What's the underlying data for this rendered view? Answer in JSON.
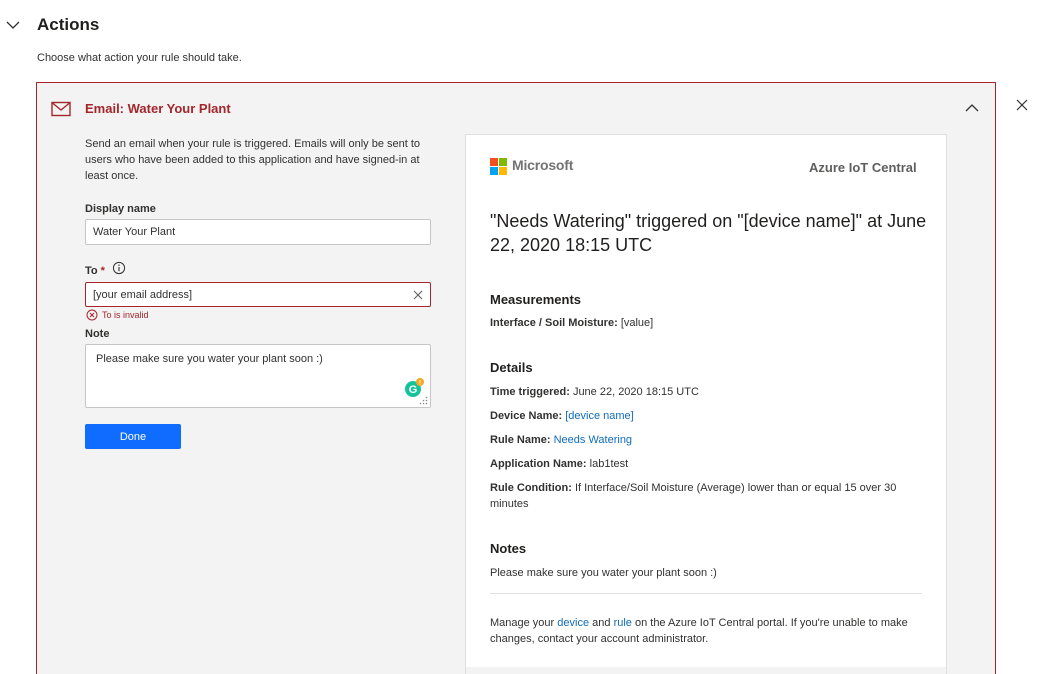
{
  "section": {
    "title": "Actions",
    "description": "Choose what action your rule should take."
  },
  "card": {
    "title": "Email: Water Your Plant",
    "intro": "Send an email when your rule is triggered. Emails will only be sent to users who have been added to this application and have signed-in at least once.",
    "display_name_label": "Display name",
    "display_name_value": "Water Your Plant",
    "to_label": "To",
    "to_required": "*",
    "to_value": "[your email address]",
    "to_error": "To is invalid",
    "note_label": "Note",
    "note_value": "Please make sure you water your plant soon :)",
    "done_label": "Done"
  },
  "preview": {
    "brand": "Microsoft",
    "product": "Azure IoT Central",
    "headline": "\"Needs Watering\" triggered on \"[device name]\" at June 22, 2020 18:15 UTC",
    "measurements_heading": "Measurements",
    "measurement_label": "Interface / Soil Moisture:",
    "measurement_value": "[value]",
    "details_heading": "Details",
    "time_label": "Time triggered:",
    "time_value": "June 22, 2020 18:15 UTC",
    "device_label": "Device Name:",
    "device_value": "[device name]",
    "rule_label": "Rule Name:",
    "rule_value": "Needs Watering",
    "app_label": "Application Name:",
    "app_value": "lab1test",
    "condition_label": "Rule Condition:",
    "condition_value": "If Interface/Soil Moisture (Average) lower than or equal 15 over 30 minutes",
    "notes_heading": "Notes",
    "notes_value": "Please make sure you water your plant soon :)",
    "footer_1": "Manage your",
    "footer_device_link": "device",
    "footer_2": "and",
    "footer_rule_link": "rule",
    "footer_3": "on the Azure IoT Central portal. If you're unable to make changes, contact your account administrator."
  },
  "colors": {
    "error": "#a4262c",
    "accent": "#0f6cff",
    "link": "#0f6cbd",
    "panel_bg": "#f3f3f3"
  },
  "icons": [
    "chevron-down-icon",
    "close-icon",
    "mail-icon",
    "chevron-up-icon",
    "info-icon",
    "clear-icon",
    "error-icon",
    "grammarly-icon",
    "resize-grip-icon",
    "microsoft-logo-icon"
  ]
}
